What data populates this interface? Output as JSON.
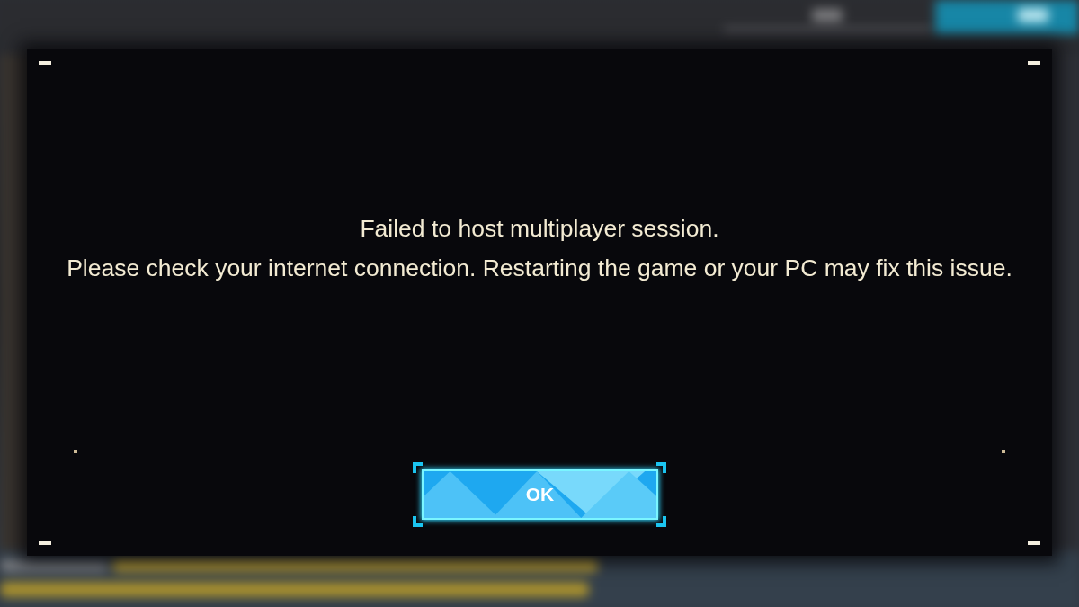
{
  "dialog": {
    "message": [
      "Failed to host multiplayer session.",
      "Please check your internet connection. Restarting the game or your PC may fix this issue."
    ],
    "button": {
      "label": "OK"
    }
  }
}
